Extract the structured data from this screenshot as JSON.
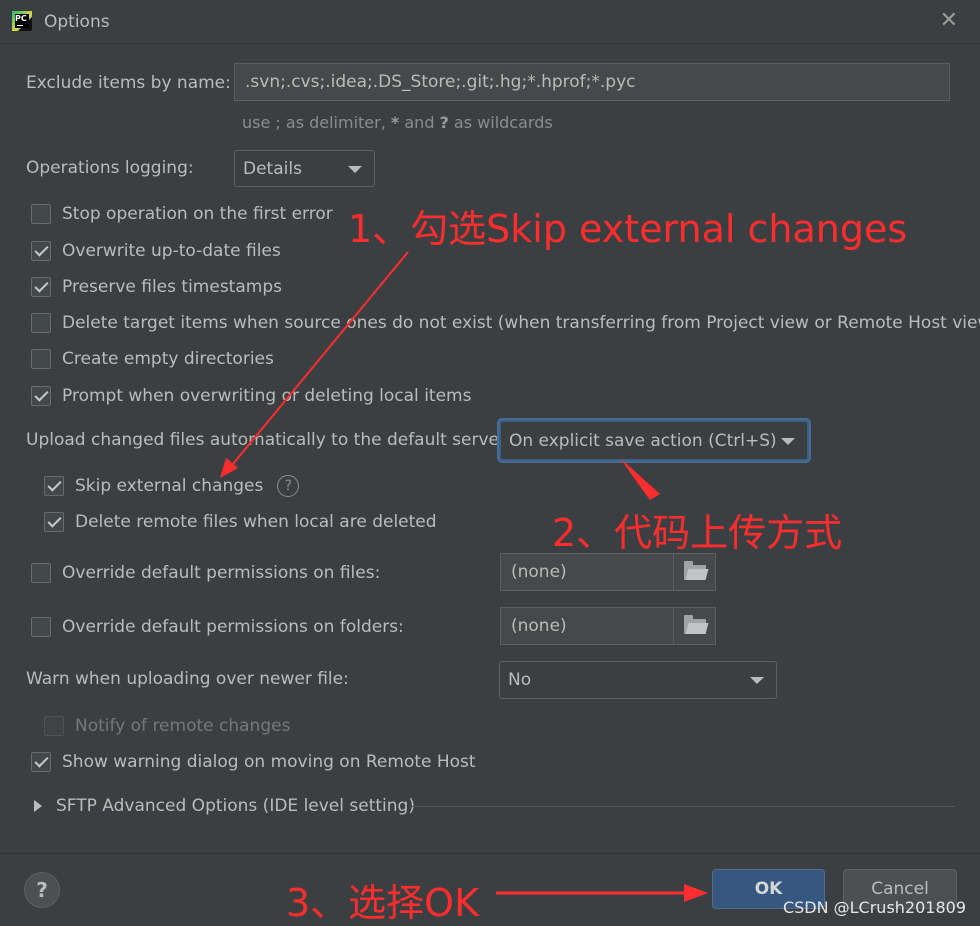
{
  "window": {
    "title": "Options",
    "app_icon_text": "PC"
  },
  "form": {
    "exclude_label": "Exclude items by name:",
    "exclude_value": ".svn;.cvs;.idea;.DS_Store;.git;.hg;*.hprof;*.pyc",
    "exclude_hint_pre": "use ; as delimiter, ",
    "exclude_hint_star": "*",
    "exclude_hint_mid": " and ",
    "exclude_hint_q": "?",
    "exclude_hint_post": " as wildcards",
    "logging_label": "Operations logging:",
    "logging_value": "Details",
    "checkboxes": [
      {
        "label": "Stop operation on the first error",
        "checked": false
      },
      {
        "label": "Overwrite up-to-date files",
        "checked": true
      },
      {
        "label": "Preserve files timestamps",
        "checked": true
      },
      {
        "label": "Delete target items when source ones do not exist (when transferring from Project view or Remote Host view)",
        "checked": false
      },
      {
        "label": "Create empty directories",
        "checked": false
      },
      {
        "label": "Prompt when overwriting or deleting local items",
        "checked": true
      }
    ],
    "upload_label": "Upload changed files automatically to the default server",
    "upload_value": "On explicit save action (Ctrl+S)",
    "skip_external_label": "Skip external changes",
    "skip_external_checked": true,
    "help_icon_text": "?",
    "delete_remote_label": "Delete remote files when local are deleted",
    "delete_remote_checked": true,
    "override_files_label": "Override default permissions on files:",
    "override_files_value": "(none)",
    "override_folders_label": "Override default permissions on folders:",
    "override_folders_value": "(none)",
    "warn_label": "Warn when uploading over newer file:",
    "warn_value": "No",
    "notify_label": "Notify of remote changes",
    "show_warning_label": "Show warning dialog on moving on Remote Host",
    "sftp_section_label": "SFTP Advanced Options (IDE level setting)"
  },
  "footer": {
    "help_label": "?",
    "ok_label": "OK",
    "cancel_label": "Cancel"
  },
  "annotations": {
    "step1": "1、勾选Skip external changes",
    "step2": "2、代码上传方式",
    "step3": "3、选择OK",
    "color": "#ff2d2d"
  },
  "watermark": "CSDN @LCrush201809"
}
